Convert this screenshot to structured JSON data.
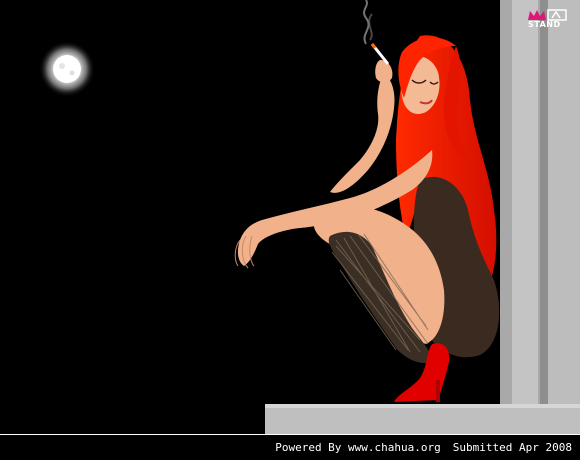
{
  "logo": {
    "text": "STAND",
    "accent_color": "#e0177b"
  },
  "footer": {
    "powered_by": "Powered By www.chahua.org",
    "submitted": "Submitted Apr 2008"
  },
  "colors": {
    "background": "#000000",
    "hair": "#ff1a00",
    "dress": "#3a2a20",
    "skin": "#f2b48f",
    "shoe": "#e00000",
    "wall_light": "#b8b8b8",
    "wall_mid": "#9a9a9a"
  }
}
